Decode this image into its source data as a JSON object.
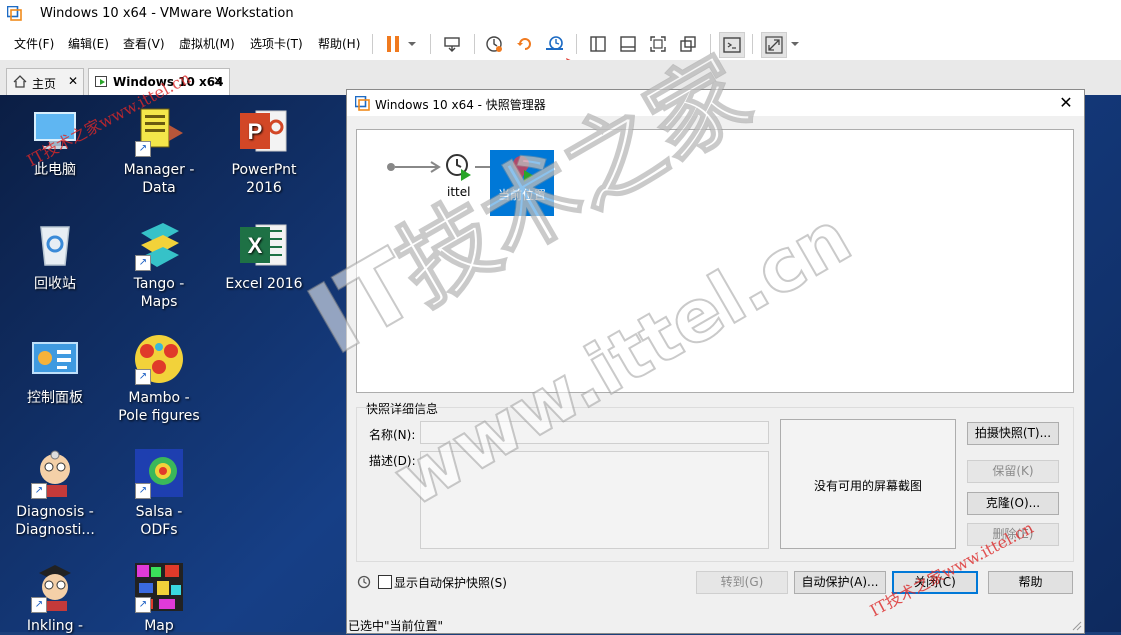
{
  "window": {
    "title": "Windows 10 x64 - VMware Workstation"
  },
  "menu": [
    "文件(F)",
    "编辑(E)",
    "查看(V)",
    "虚拟机(M)",
    "选项卡(T)",
    "帮助(H)"
  ],
  "tabs": [
    {
      "label": "主页",
      "active": false
    },
    {
      "label": "Windows 10 x64",
      "active": true
    }
  ],
  "desktop_icons": [
    {
      "label": "此电脑",
      "icon": "this-pc-icon"
    },
    {
      "label": "Manager -\nData",
      "icon": "manager-data-icon"
    },
    {
      "label": "PowerPnt\n2016",
      "icon": "powerpoint-icon"
    },
    {
      "label": "回收站",
      "icon": "recycle-bin-icon"
    },
    {
      "label": "Tango -\nMaps",
      "icon": "tango-maps-icon"
    },
    {
      "label": "Excel 2016",
      "icon": "excel-icon"
    },
    {
      "label": "控制面板",
      "icon": "control-panel-icon"
    },
    {
      "label": "Mambo -\nPole figures",
      "icon": "mambo-icon"
    },
    {
      "label": "Diagnosis -\nDiagnosti...",
      "icon": "diagnosis-icon"
    },
    {
      "label": "Salsa -\nODFs",
      "icon": "salsa-icon"
    },
    {
      "label": "Inkling -",
      "icon": "inkling-icon"
    },
    {
      "label": "Map",
      "icon": "map-icon"
    }
  ],
  "dialog": {
    "title": "Windows 10 x64 - 快照管理器",
    "snapshot_node": "ittel",
    "current_node": "当前位置",
    "details_group": "快照详细信息",
    "name_label": "名称(N):",
    "desc_label": "描述(D):",
    "no_screenshot": "没有可用的屏幕截图",
    "buttons": {
      "take": "拍摄快照(T)...",
      "keep": "保留(K)",
      "clone": "克隆(O)...",
      "delete": "删除(E)",
      "goto": "转到(G)",
      "autoprotect": "自动保护(A)...",
      "close": "关闭(C)",
      "help": "帮助"
    },
    "show_autoprotect": "显示自动保护快照(S)",
    "status": "已选中\"当前位置\""
  },
  "watermark": {
    "big": "IT技术之家",
    "url": "www.ittel.cn",
    "small": "IT技术之家www.ittel.cn"
  },
  "colors": {
    "accent": "#0078d7",
    "pause": "#f07a1f",
    "arrow": "#e0423a"
  }
}
